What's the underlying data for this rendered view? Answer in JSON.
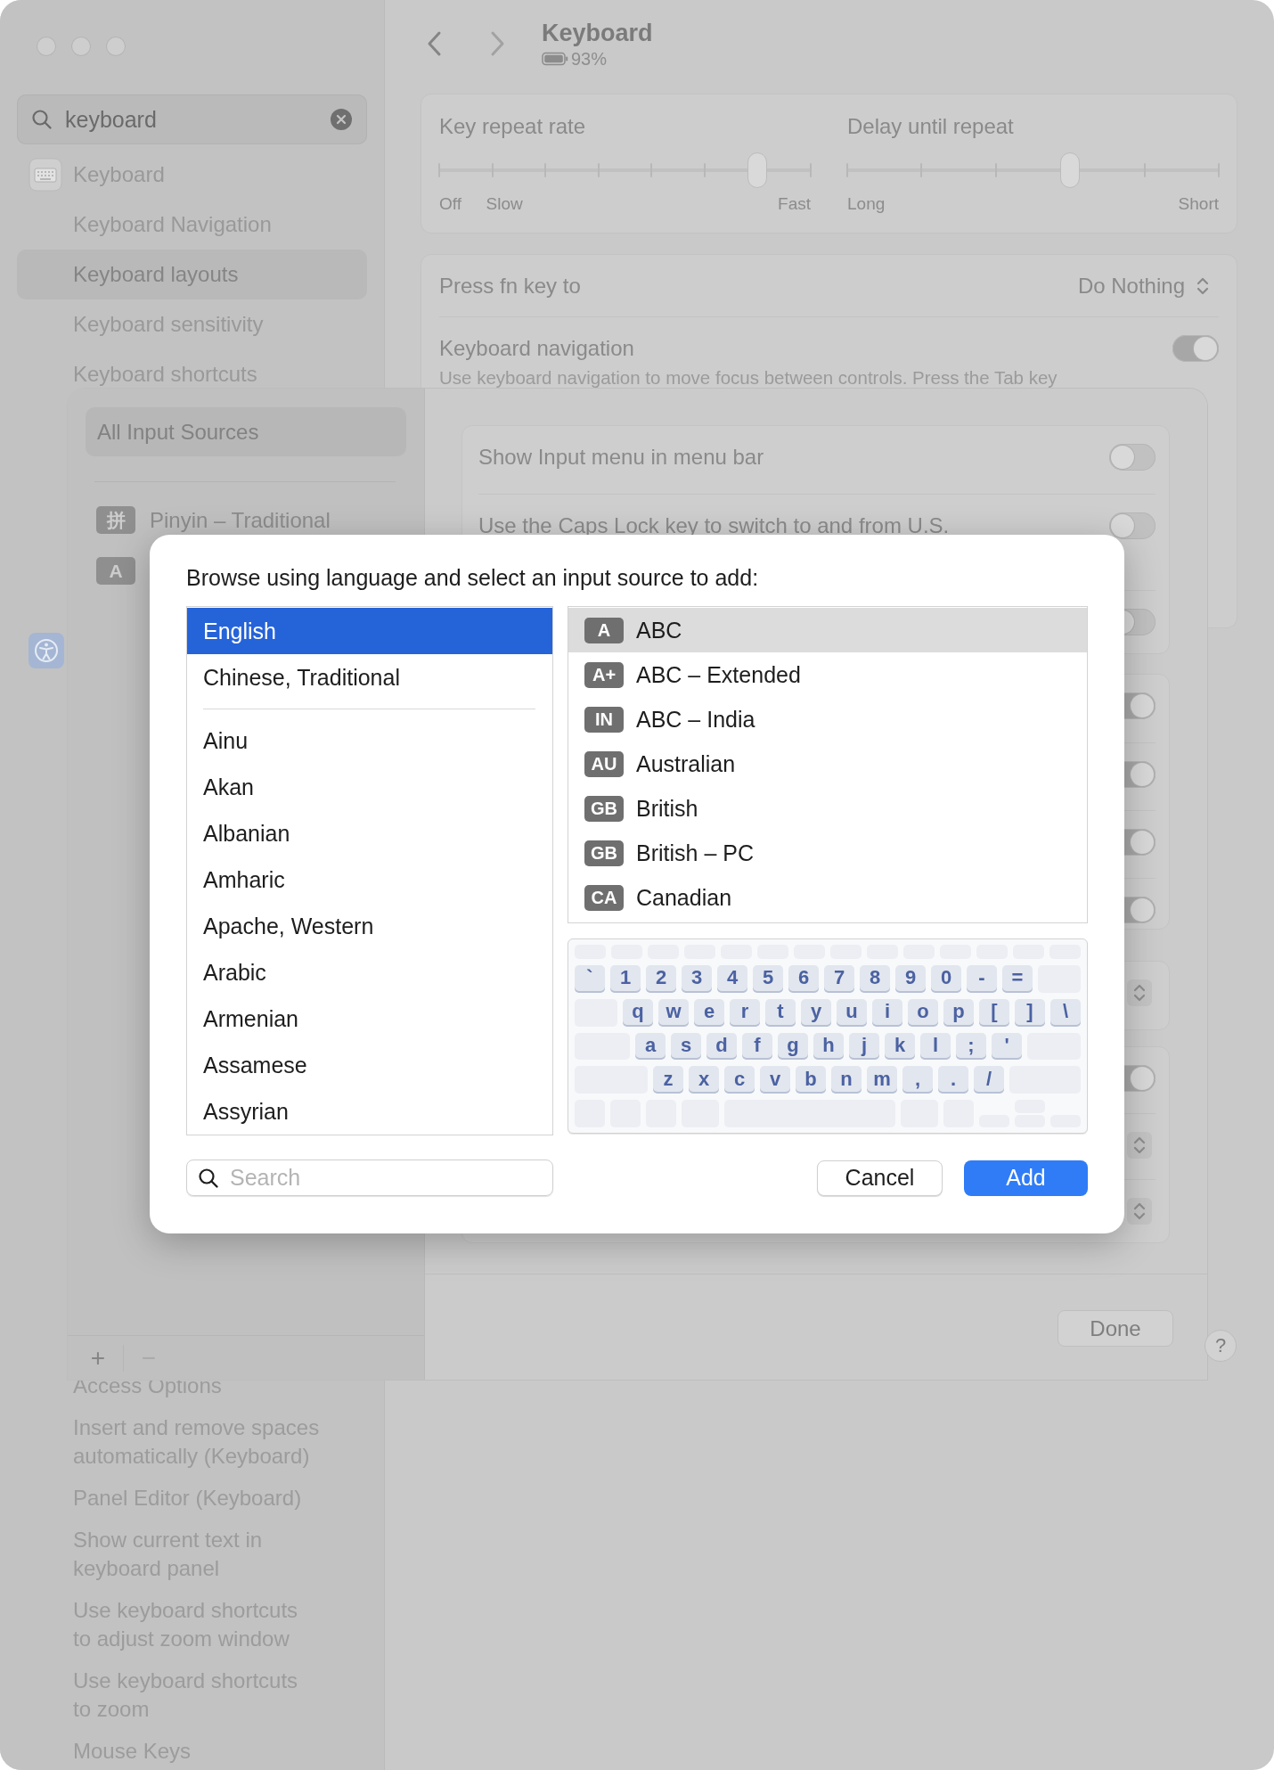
{
  "sidebar": {
    "search": {
      "value": "keyboard"
    },
    "items": [
      {
        "kind": "category",
        "label": "Keyboard",
        "selected": false
      },
      {
        "kind": "result",
        "label": "Keyboard Navigation",
        "selected": false
      },
      {
        "kind": "result",
        "label": "Keyboard layouts",
        "selected": true
      },
      {
        "kind": "result",
        "label": "Keyboard sensitivity",
        "selected": false
      },
      {
        "kind": "result",
        "label": "Keyboard shortcuts",
        "selected": false
      }
    ],
    "more_items": [
      {
        "label": "Access Options"
      },
      {
        "label": "Insert and remove spaces automatically (Keyboard)"
      },
      {
        "label": "Panel Editor (Keyboard)"
      },
      {
        "label": "Show current text in keyboard panel"
      },
      {
        "label": "Use keyboard shortcuts to adjust zoom window"
      },
      {
        "label": "Use keyboard shortcuts to zoom"
      },
      {
        "label": "Mouse Keys"
      }
    ]
  },
  "header": {
    "title": "Keyboard",
    "battery": "93%"
  },
  "repeat_card": {
    "sliders": [
      {
        "label": "Key repeat rate",
        "level": 0.857,
        "scale": [
          "Off",
          "Slow",
          "Fast"
        ]
      },
      {
        "label": "Delay until repeat",
        "level": 0.6,
        "scale": [
          "Long",
          "Short"
        ]
      }
    ]
  },
  "keyboard_card": {
    "rows": [
      {
        "kind": "popup",
        "label": "Press fn key to",
        "value": "Do Nothing"
      },
      {
        "kind": "toggle",
        "label": "Keyboard navigation",
        "on": true,
        "description": "Use keyboard navigation to move focus between controls. Press the Tab key"
      }
    ]
  },
  "help_button": "?",
  "input_sheet": {
    "filter": {
      "label": "All Input Sources",
      "selected": true
    },
    "sources": [
      {
        "badge": "拼",
        "name": "Pinyin – Traditional"
      },
      {
        "badge": "A"
      }
    ],
    "add_button": "+",
    "remove_button": {
      "label": "−",
      "disabled": true
    },
    "option_groups": [
      {
        "options": [
          {
            "kind": "toggle",
            "label": "Show Input menu in menu bar",
            "on": false
          },
          {
            "kind": "toggle",
            "label": "Use the Caps Lock key to switch to and from U.S.",
            "on": false
          },
          {
            "kind": "toggle",
            "on": false
          }
        ]
      },
      {
        "options": [
          {
            "kind": "toggle",
            "on": true
          },
          {
            "kind": "toggle",
            "on": true
          },
          {
            "kind": "toggle",
            "on": true
          },
          {
            "kind": "toggle",
            "on": true
          }
        ]
      },
      {
        "options": [
          {
            "kind": "popup"
          }
        ]
      },
      {
        "options": [
          {
            "kind": "toggle",
            "on": true
          },
          {
            "kind": "popup"
          },
          {
            "kind": "popup"
          }
        ]
      }
    ],
    "done_button": "Done"
  },
  "dialog": {
    "prompt": "Browse using language and select an input source to add:",
    "preferred_languages": [
      {
        "name": "English",
        "selected": true
      },
      {
        "name": "Chinese, Traditional",
        "selected": false
      }
    ],
    "languages": [
      {
        "name": "Ainu",
        "selected": false
      },
      {
        "name": "Akan",
        "selected": false
      },
      {
        "name": "Albanian",
        "selected": false
      },
      {
        "name": "Amharic",
        "selected": false
      },
      {
        "name": "Apache, Western",
        "selected": false
      },
      {
        "name": "Arabic",
        "selected": false
      },
      {
        "name": "Armenian",
        "selected": false
      },
      {
        "name": "Assamese",
        "selected": false
      },
      {
        "name": "Assyrian",
        "selected": false
      }
    ],
    "input_sources": [
      {
        "badge": "A",
        "name": "ABC",
        "selected": true
      },
      {
        "badge": "A+",
        "name": "ABC – Extended",
        "selected": false
      },
      {
        "badge": "IN",
        "name": "ABC – India",
        "selected": false
      },
      {
        "badge": "AU",
        "name": "Australian",
        "selected": false
      },
      {
        "badge": "GB",
        "name": "British",
        "selected": false
      },
      {
        "badge": "GB",
        "name": "British – PC",
        "selected": false
      },
      {
        "badge": "CA",
        "name": "Canadian",
        "selected": false
      }
    ],
    "keyboard": {
      "rows": [
        {
          "keys": [
            "`",
            "1",
            "2",
            "3",
            "4",
            "5",
            "6",
            "7",
            "8",
            "9",
            "0",
            "-",
            "="
          ]
        },
        {
          "keys": [
            "q",
            "w",
            "e",
            "r",
            "t",
            "y",
            "u",
            "i",
            "o",
            "p",
            "[",
            "]",
            "\\"
          ]
        },
        {
          "keys": [
            "a",
            "s",
            "d",
            "f",
            "g",
            "h",
            "j",
            "k",
            "l",
            ";",
            "'"
          ]
        },
        {
          "keys": [
            "z",
            "x",
            "c",
            "v",
            "b",
            "n",
            "m",
            ",",
            ".",
            "/"
          ]
        }
      ]
    },
    "search": {
      "placeholder": "Search"
    },
    "buttons": [
      {
        "kind": "cancel",
        "label": "Cancel"
      },
      {
        "kind": "default",
        "label": "Add"
      }
    ]
  }
}
